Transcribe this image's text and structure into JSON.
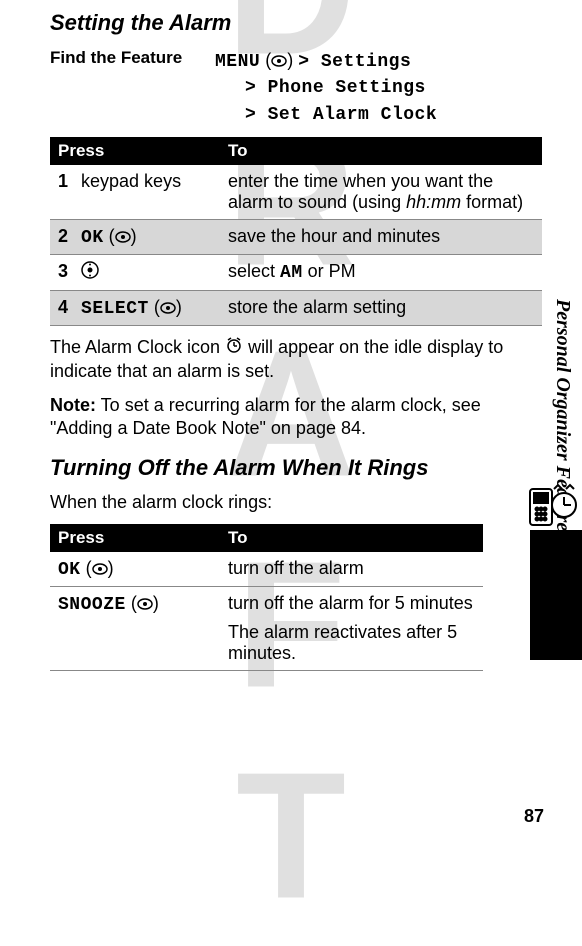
{
  "watermark": "DRAFT",
  "side_label": "Personal Organizer Features",
  "section_title": "Setting the Alarm",
  "find_feature": {
    "label": "Find the Feature",
    "menu_word": "MENU",
    "path1": "> Settings",
    "path2": "> Phone Settings",
    "path3": "> Set Alarm Clock"
  },
  "table1": {
    "head_press": "Press",
    "head_to": "To",
    "rows": [
      {
        "num": "1",
        "press": "keypad keys",
        "to_a": "enter the time when you want the alarm to sound (using ",
        "to_i": "hh:mm",
        "to_b": " format)",
        "shaded": false
      },
      {
        "num": "2",
        "press_lcd": "OK",
        "press_suffix": "",
        "to": "save the hour and minutes",
        "shaded": true,
        "icon": "dot"
      },
      {
        "num": "3",
        "press": "",
        "to_a": "select ",
        "to_lcd": "AM",
        "to_b": " or PM",
        "shaded": false,
        "icon": "nav"
      },
      {
        "num": "4",
        "press_lcd": "SELECT",
        "press_suffix": "",
        "to": "store the alarm setting",
        "shaded": true,
        "icon": "dot"
      }
    ]
  },
  "para1_a": "The Alarm Clock icon ",
  "para1_b": " will appear on the idle display to indicate that an alarm is set.",
  "note_label": "Note:",
  "note_text": " To set a recurring alarm for the alarm clock, see \"Adding a Date Book Note\" on page 84.",
  "subsection_title": "Turning Off the Alarm When It Rings",
  "para2": "When the alarm clock rings:",
  "table2": {
    "head_press": "Press",
    "head_to": "To",
    "rows": [
      {
        "press_lcd": "OK",
        "to": "turn off the alarm"
      },
      {
        "press_lcd": "SNOOZE",
        "to": "turn off the alarm for 5 minutes",
        "extra": "The alarm reactivates after 5 minutes."
      }
    ]
  },
  "page_number": "87"
}
